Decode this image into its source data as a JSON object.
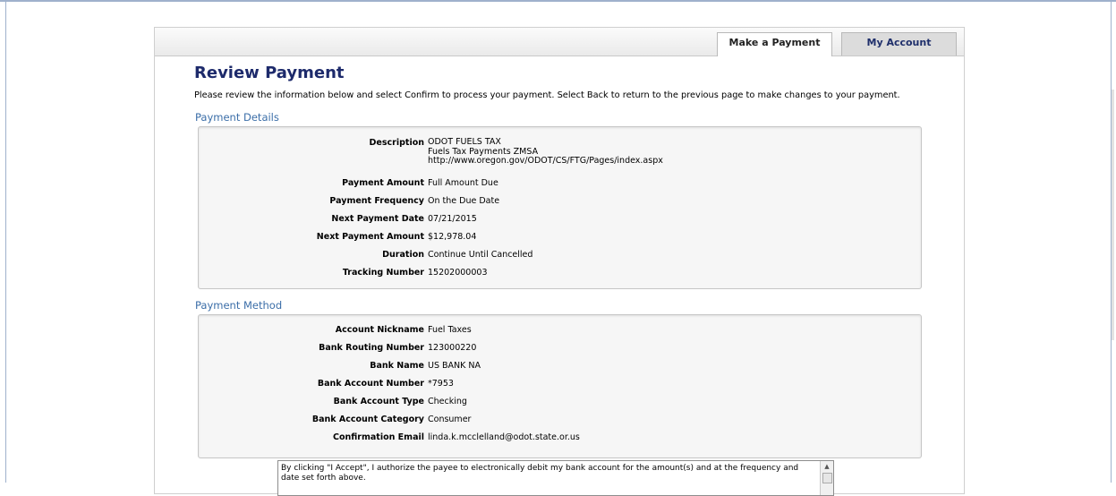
{
  "tabs": {
    "make_payment": "Make a Payment",
    "my_account": "My Account"
  },
  "page": {
    "title": "Review Payment",
    "intro": "Please review the information below and select Confirm to process your payment. Select Back to return to the previous page to make changes to your payment."
  },
  "payment_details": {
    "title": "Payment Details",
    "description_label": "Description",
    "description_line1": "ODOT FUELS TAX",
    "description_line2": "Fuels Tax Payments ZMSA",
    "description_line3": "http://www.oregon.gov/ODOT/CS/FTG/Pages/index.aspx",
    "amount_label": "Payment Amount",
    "amount_value": "Full Amount Due",
    "frequency_label": "Payment Frequency",
    "frequency_value": "On the Due Date",
    "next_date_label": "Next Payment Date",
    "next_date_value": "07/21/2015",
    "next_amount_label": "Next Payment Amount",
    "next_amount_value": "$12,978.04",
    "duration_label": "Duration",
    "duration_value": "Continue Until Cancelled",
    "tracking_label": "Tracking Number",
    "tracking_value": "15202000003"
  },
  "payment_method": {
    "title": "Payment Method",
    "nickname_label": "Account Nickname",
    "nickname_value": "Fuel Taxes",
    "routing_label": "Bank Routing Number",
    "routing_value": "123000220",
    "bank_name_label": "Bank Name",
    "bank_name_value": "US BANK NA",
    "account_number_label": "Bank Account Number",
    "account_number_value": "*7953",
    "account_type_label": "Bank Account Type",
    "account_type_value": "Checking",
    "account_category_label": "Bank Account Category",
    "account_category_value": "Consumer",
    "email_label": "Confirmation Email",
    "email_value": "linda.k.mcclelland@odot.state.or.us"
  },
  "consent": {
    "text": "By clicking \"I Accept\", I authorize the payee to electronically debit my bank account for the amount(s) and at the frequency and date set forth above."
  }
}
